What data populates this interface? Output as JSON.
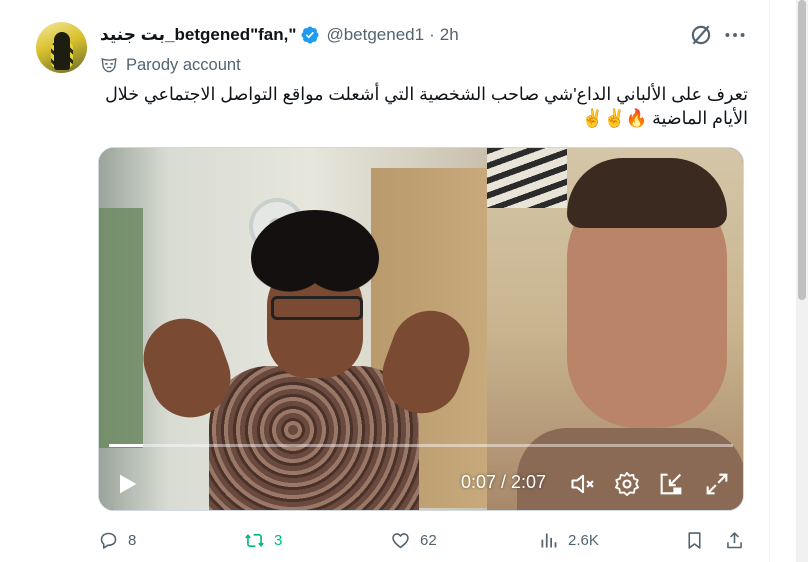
{
  "author": {
    "display_name": "بت جنيد_betgened\"fan,\"",
    "handle": "@betgened1",
    "separator": "·",
    "time": "2h",
    "verified_color": "#1d9bf0"
  },
  "parody_label": "Parody account",
  "tweet_text": "تعرف على الألباني  الداع'شي صاحب الشخصية التي أشعلت مواقع التواصل الاجتماعي خلال الأيام الماضية 🔥✌️✌️",
  "video": {
    "current_time": "0:07",
    "duration": "2:07",
    "time_display": "0:07 / 2:07",
    "progress_fraction": 0.055
  },
  "actions": {
    "replies": "8",
    "reposts": "3",
    "likes": "62",
    "views": "2.6K"
  },
  "colors": {
    "accent": "#1d9bf0",
    "repost_active": "#00ba7c",
    "muted_text": "#536471"
  }
}
